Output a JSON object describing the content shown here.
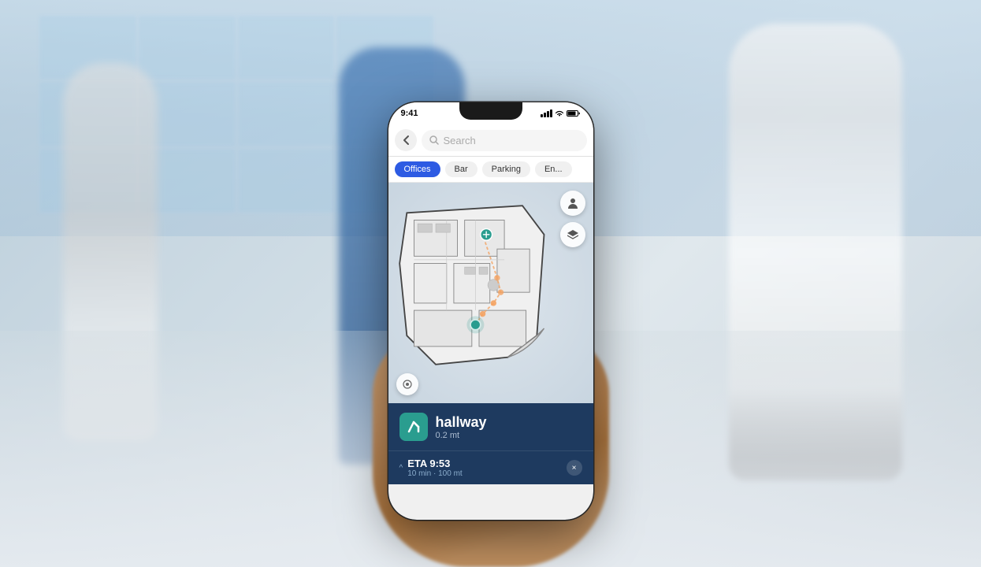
{
  "scene": {
    "background_description": "Hospital exterior, blurred people walking"
  },
  "phone": {
    "status_bar": {
      "time": "9:41",
      "signal_label": "signal",
      "wifi_label": "wifi",
      "battery_label": "battery"
    },
    "search": {
      "placeholder": "Search",
      "back_label": "←"
    },
    "categories": [
      {
        "label": "Offices",
        "active": true
      },
      {
        "label": "Bar",
        "active": false
      },
      {
        "label": "Parking",
        "active": false
      },
      {
        "label": "En...",
        "active": false
      }
    ],
    "map": {
      "user_btn_icon": "👤",
      "layers_btn_icon": "⊞",
      "location_btn_icon": "◎"
    },
    "navigation": {
      "destination": "hallway",
      "distance": "0.2 mt",
      "arrow_label": "turn-right"
    },
    "eta": {
      "label": "ETA 9:53",
      "details": "10 min · 100 mt",
      "expand_icon": "^",
      "close_icon": "×"
    }
  }
}
